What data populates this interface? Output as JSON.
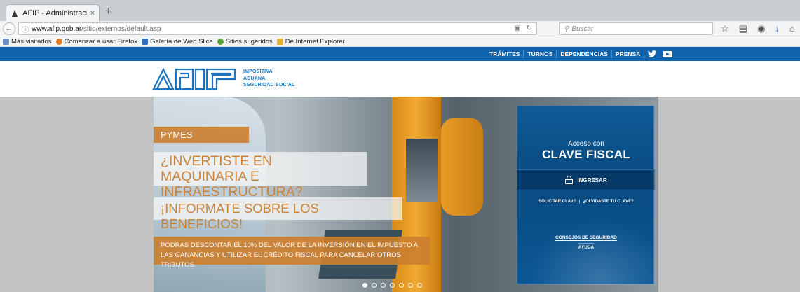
{
  "browser": {
    "tab_title": "AFIP - Administración Fed...",
    "tab_close": "×",
    "new_tab": "+",
    "url_domain": "www.afip.gob.ar",
    "url_path": "/sitio/externos/default.asp",
    "search_placeholder": "Buscar",
    "bookmarks": [
      {
        "label": "Más visitados",
        "color": "#6c8ebf"
      },
      {
        "label": "Comenzar a usar Firefox",
        "color": "#e07a20"
      },
      {
        "label": "Galería de Web Slice",
        "color": "#2a6fb8"
      },
      {
        "label": "Sitios sugeridos",
        "color": "#5aa03a"
      },
      {
        "label": "De Internet Explorer",
        "color": "#e0b030"
      }
    ]
  },
  "topnav": {
    "items": [
      "TRÁMITES",
      "TURNOS",
      "DEPENDENCIAS",
      "PRENSA"
    ],
    "social": [
      "twitter-icon",
      "youtube-icon"
    ]
  },
  "header": {
    "logo_text": "AFIP",
    "subtitle_lines": [
      "IMPOSITIVA",
      "ADUANA",
      "SEGURIDAD SOCIAL"
    ]
  },
  "hero": {
    "badge": "PYMES",
    "title_1": "¿INVERTISTE EN MAQUINARIA E INFRAESTRUCTURA?",
    "title_2": "¡INFORMATE SOBRE LOS BENEFICIOS!",
    "description": "PODRÁS DESCONTAR EL 10% DEL VALOR DE LA INVERSIÓN EN EL IMPUESTO A LAS GANANCIAS Y UTILIZAR EL CRÉDITO FISCAL PARA CANCELAR OTROS TRIBUTOS.",
    "active_slide": 1
  },
  "login": {
    "access_label": "Acceso con",
    "title": "CLAVE FISCAL",
    "ingresar": "INGRESAR",
    "solicitar": "SOLICITAR CLAVE",
    "olvidaste": "¿OLVIDASTE TU CLAVE?",
    "consejos": "CONSEJOS DE SEGURIDAD",
    "ayuda": "AYUDA"
  },
  "colors": {
    "brand_blue": "#0e63ac",
    "accent_orange": "#cc8030"
  }
}
